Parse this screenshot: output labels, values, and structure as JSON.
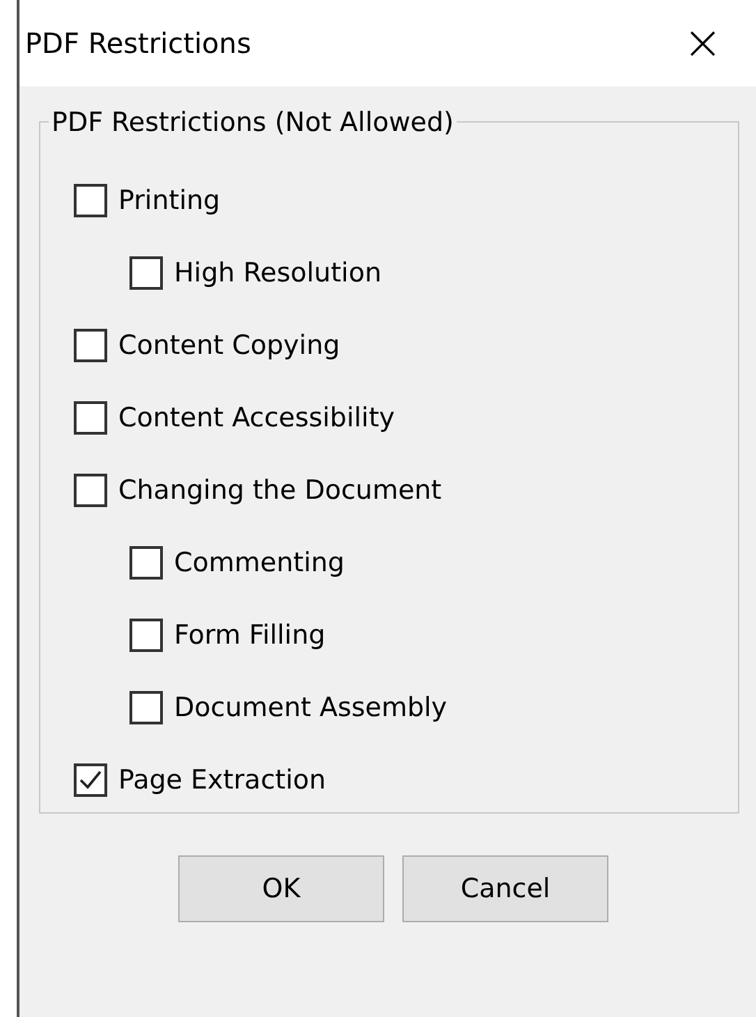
{
  "window": {
    "title": "PDF Restrictions",
    "close": "×"
  },
  "group": {
    "legend": "PDF Restrictions (Not Allowed)",
    "items": [
      {
        "label": "Printing",
        "checked": false,
        "children": [
          {
            "label": "High Resolution",
            "checked": false
          }
        ]
      },
      {
        "label": "Content Copying",
        "checked": false
      },
      {
        "label": "Content Accessibility",
        "checked": false
      },
      {
        "label": "Changing the Document",
        "checked": false,
        "children": [
          {
            "label": "Commenting",
            "checked": false
          },
          {
            "label": "Form Filling",
            "checked": false
          },
          {
            "label": "Document Assembly",
            "checked": false
          }
        ]
      },
      {
        "label": "Page Extraction",
        "checked": true
      }
    ]
  },
  "buttons": [
    "OK",
    "Cancel"
  ]
}
